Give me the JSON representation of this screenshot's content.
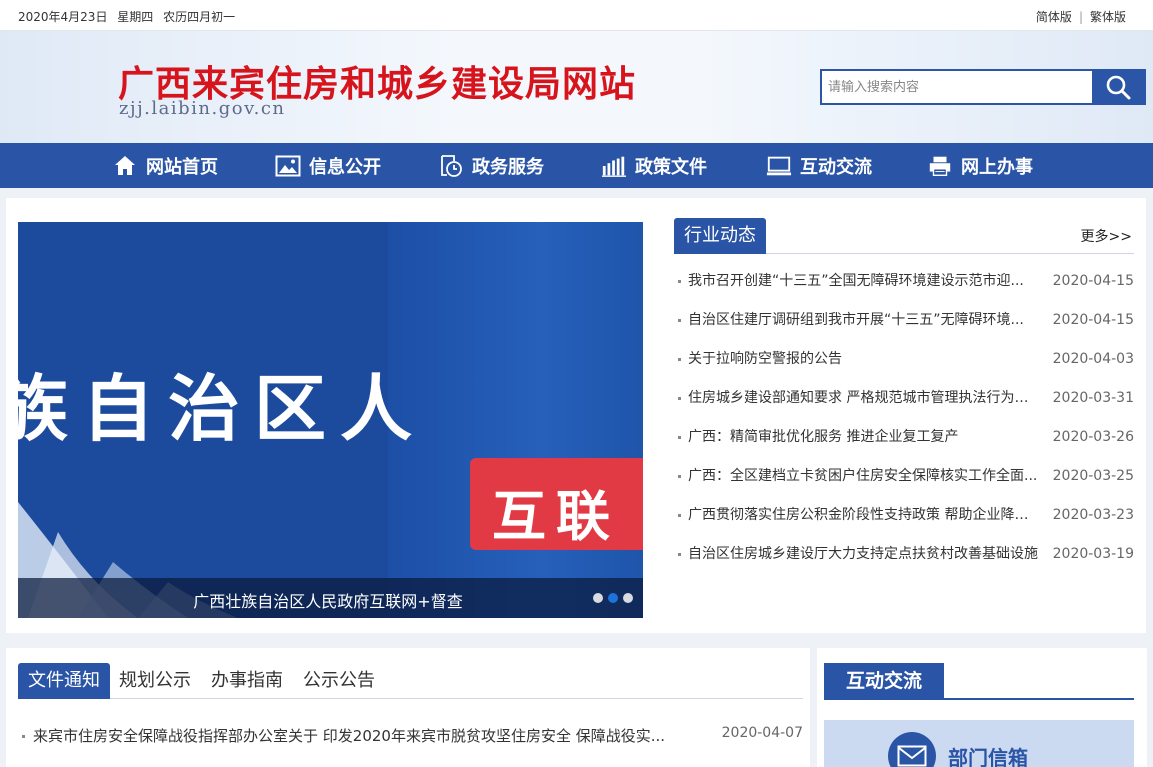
{
  "topbar": {
    "date": "2020年4月23日",
    "weekday": "星期四",
    "lunar": "农历四月初一",
    "simplified": "简体版",
    "separator": "|",
    "traditional": "繁体版"
  },
  "header": {
    "title": "广西来宾住房和城乡建设局网站",
    "domain": "zjj.laibin.gov.cn",
    "search_placeholder": "请输入搜索内容"
  },
  "nav": {
    "items": [
      {
        "label": "网站首页",
        "icon": "home-icon"
      },
      {
        "label": "信息公开",
        "icon": "image-icon"
      },
      {
        "label": "政务服务",
        "icon": "clock-document-icon"
      },
      {
        "label": "政策文件",
        "icon": "bar-chart-icon"
      },
      {
        "label": "互动交流",
        "icon": "monitor-icon"
      },
      {
        "label": "网上办事",
        "icon": "printer-icon"
      }
    ]
  },
  "banner": {
    "big_text": "族自治区人",
    "red_text": "互联",
    "caption": "广西壮族自治区人民政府互联网+督查",
    "slide_count": 3,
    "active_slide": 2
  },
  "news": {
    "tab": "行业动态",
    "more": "更多>>",
    "items": [
      {
        "title": "我市召开创建“十三五”全国无障碍环境建设示范市迎...",
        "date": "2020-04-15"
      },
      {
        "title": "自治区住建厅调研组到我市开展“十三五”无障碍环境...",
        "date": "2020-04-15"
      },
      {
        "title": "关于拉响防空警报的公告",
        "date": "2020-04-03"
      },
      {
        "title": "住房城乡建设部通知要求 严格规范城市管理执法行为严...",
        "date": "2020-03-31"
      },
      {
        "title": "广西：精简审批优化服务 推进企业复工复产",
        "date": "2020-03-26"
      },
      {
        "title": "广西：全区建档立卡贫困户住房安全保障核实工作全面...",
        "date": "2020-03-25"
      },
      {
        "title": "广西贯彻落实住房公积金阶段性支持政策 帮助企业降费...",
        "date": "2020-03-23"
      },
      {
        "title": "自治区住房城乡建设厅大力支持定点扶贫村改善基础设施",
        "date": "2020-03-19"
      }
    ]
  },
  "files": {
    "tabs": [
      "文件通知",
      "规划公示",
      "办事指南",
      "公示公告"
    ],
    "active_tab": 0,
    "items": [
      {
        "title": "来宾市住房安全保障战役指挥部办公室关于 印发2020年来宾市脱贫攻坚住房安全 保障战役实...",
        "date": "2020-04-07"
      }
    ]
  },
  "interaction": {
    "tab": "互动交流",
    "mailbox_label": "部门信箱"
  },
  "colors": {
    "brand_blue": "#2a54a5",
    "title_red": "#d7131c",
    "banner_red": "#e23a44"
  }
}
